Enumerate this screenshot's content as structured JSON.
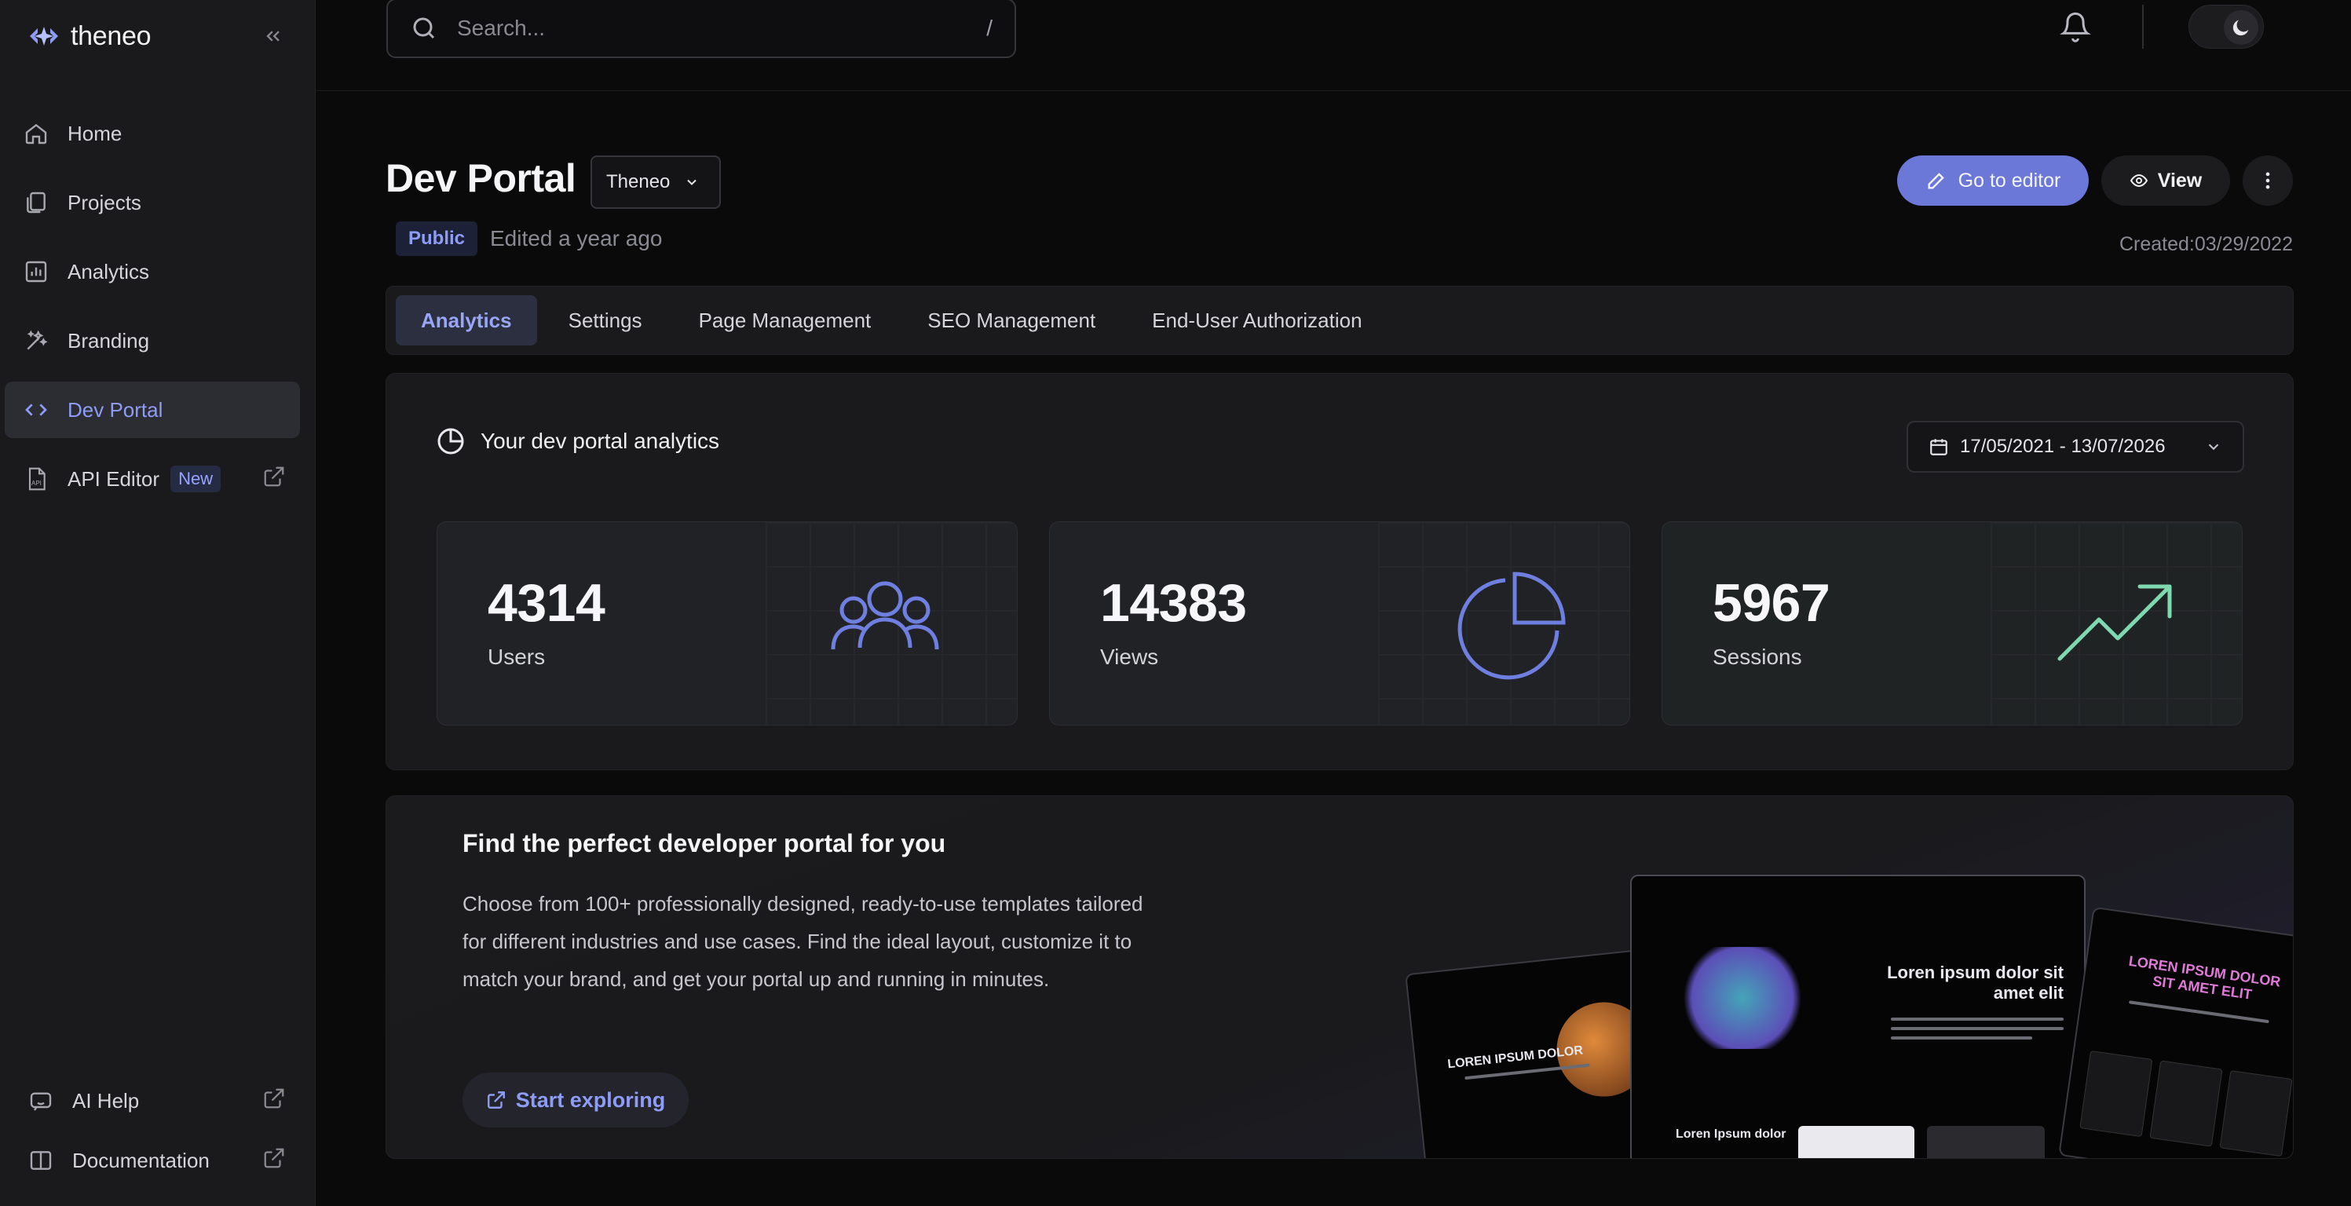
{
  "app": {
    "name": "theneo"
  },
  "sidebar": {
    "items": [
      {
        "label": "Home",
        "icon": "home-icon"
      },
      {
        "label": "Projects",
        "icon": "projects-icon"
      },
      {
        "label": "Analytics",
        "icon": "analytics-icon"
      },
      {
        "label": "Branding",
        "icon": "branding-icon"
      },
      {
        "label": "Dev Portal",
        "icon": "code-icon",
        "active": true
      },
      {
        "label": "API Editor",
        "badge": "New",
        "icon": "api-doc-icon",
        "external": true
      }
    ],
    "bottom": [
      {
        "label": "AI Help",
        "icon": "ai-help-icon",
        "external": true
      },
      {
        "label": "Documentation",
        "icon": "book-icon",
        "external": true
      }
    ]
  },
  "search": {
    "placeholder": "Search...",
    "shortcut": "/"
  },
  "header": {
    "title": "Dev Portal",
    "org_select": "Theneo",
    "visibility": "Public",
    "edited": "Edited a year ago",
    "created": "Created:03/29/2022",
    "go_to_editor": "Go to editor",
    "view": "View"
  },
  "tabs": [
    {
      "label": "Analytics",
      "active": true
    },
    {
      "label": "Settings"
    },
    {
      "label": "Page Management"
    },
    {
      "label": "SEO Management"
    },
    {
      "label": "End-User Authorization"
    }
  ],
  "analytics": {
    "title": "Your dev portal analytics",
    "date_range": "17/05/2021 - 13/07/2026",
    "stats": [
      {
        "value": "4314",
        "label": "Users",
        "icon": "users-icon"
      },
      {
        "value": "14383",
        "label": "Views",
        "icon": "pie-chart-icon"
      },
      {
        "value": "5967",
        "label": "Sessions",
        "icon": "trending-up-icon"
      }
    ]
  },
  "promo": {
    "title": "Find the perfect developer portal for you",
    "description": "Choose from 100+ professionally designed, ready-to-use templates tailored for different industries and use cases. Find the ideal layout, customize it to match your brand, and get your portal up and running in minutes.",
    "button": "Start exploring",
    "previews": {
      "left_heading": "LOREN IPSUM DOLOR",
      "center_heading": "Loren ipsum dolor sit amet elit",
      "center_subheading": "Loren Ipsum dolor",
      "right_heading": "LOREN IPSUM DOLOR SIT AMET ELIT"
    }
  },
  "colors": {
    "accent": "#6b78d8",
    "accent_text": "#8f9cf6",
    "background": "#0a0a0b",
    "panel": "#1a1a1c",
    "trend_green": "#7fd9b0"
  }
}
